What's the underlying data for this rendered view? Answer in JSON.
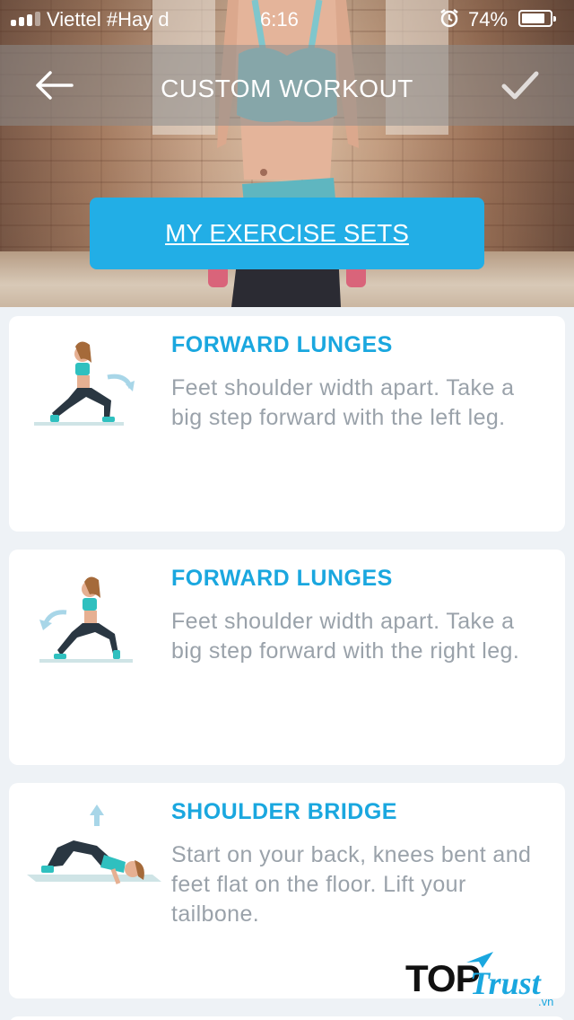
{
  "status_bar": {
    "carrier": "Viettel #Hay d",
    "time": "6:16",
    "battery": "74%",
    "battery_level": 0.74,
    "signal_bars": 4,
    "signal_bars_active": 3
  },
  "header": {
    "title": "CUSTOM WORKOUT",
    "back_icon": "arrow-left-icon",
    "confirm_icon": "checkmark-icon"
  },
  "primary_button": {
    "label": "MY EXERCISE SETS"
  },
  "exercises": [
    {
      "name": "FORWARD LUNGES",
      "description": "Feet shoulder width apart. Take a big step forward with the left leg.",
      "illustration": "forward-lunge-left-icon"
    },
    {
      "name": "FORWARD LUNGES",
      "description": "Feet shoulder width apart.  Take a big step forward with the right leg.",
      "illustration": "forward-lunge-right-icon"
    },
    {
      "name": "SHOULDER BRIDGE",
      "description": "Start on your back, knees bent and feet flat on the floor. Lift your tailbone.",
      "illustration": "shoulder-bridge-icon"
    }
  ],
  "watermark": {
    "brand_top": "TOP",
    "brand_trust": "Trust",
    "brand_tld": ".vn"
  },
  "colors": {
    "accent": "#22aee6",
    "exercise_title": "#1aa7df",
    "description_text": "#9aa2aa",
    "list_background": "#eef2f6"
  }
}
